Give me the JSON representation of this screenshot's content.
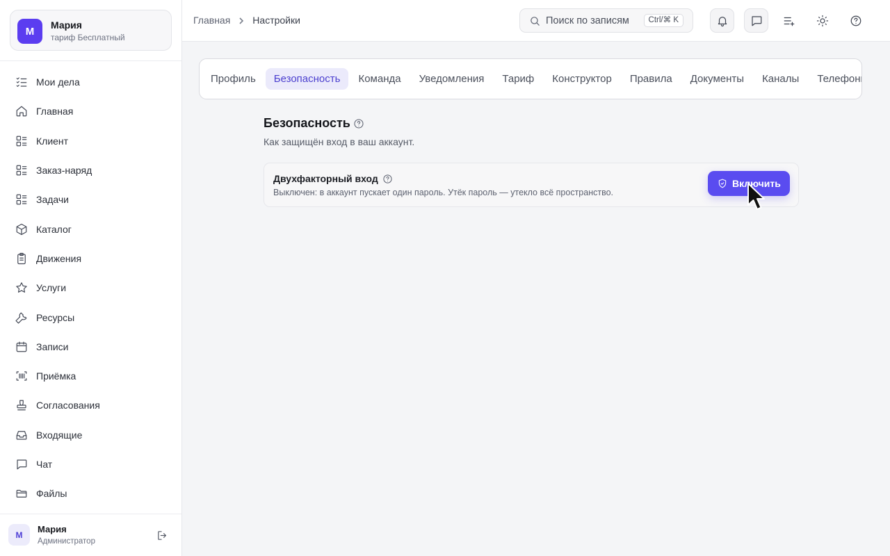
{
  "account": {
    "initial": "М",
    "name": "Мария",
    "plan": "тариф Бесплатный"
  },
  "sidebar": {
    "items": [
      {
        "label": "Мои дела",
        "icon": "list-check-icon"
      },
      {
        "label": "Главная",
        "icon": "home-icon"
      },
      {
        "label": "Клиент",
        "icon": "list-layout-icon"
      },
      {
        "label": "Заказ-наряд",
        "icon": "list-layout-icon"
      },
      {
        "label": "Задачи",
        "icon": "list-layout-icon"
      },
      {
        "label": "Каталог",
        "icon": "box-icon"
      },
      {
        "label": "Движения",
        "icon": "clipboard-icon"
      },
      {
        "label": "Услуги",
        "icon": "star-icon"
      },
      {
        "label": "Ресурсы",
        "icon": "wrench-icon"
      },
      {
        "label": "Записи",
        "icon": "calendar-icon"
      },
      {
        "label": "Приёмка",
        "icon": "barcode-scan-icon"
      },
      {
        "label": "Согласования",
        "icon": "stamp-icon"
      },
      {
        "label": "Входящие",
        "icon": "inbox-icon"
      },
      {
        "label": "Чат",
        "icon": "chat-icon"
      },
      {
        "label": "Файлы",
        "icon": "folder-icon"
      }
    ]
  },
  "user": {
    "initial": "М",
    "name": "Мария",
    "role": "Администратор"
  },
  "header": {
    "breadcrumb": {
      "home": "Главная",
      "current": "Настройки"
    },
    "search": {
      "placeholder": "Поиск по записям",
      "shortcut": "Ctrl/⌘ K"
    }
  },
  "tabs": [
    {
      "label": "Профиль",
      "active": false
    },
    {
      "label": "Безопасность",
      "active": true
    },
    {
      "label": "Команда",
      "active": false
    },
    {
      "label": "Уведомления",
      "active": false
    },
    {
      "label": "Тариф",
      "active": false
    },
    {
      "label": "Конструктор",
      "active": false
    },
    {
      "label": "Правила",
      "active": false
    },
    {
      "label": "Документы",
      "active": false
    },
    {
      "label": "Каналы",
      "active": false
    },
    {
      "label": "Телефония",
      "active": false
    }
  ],
  "section": {
    "title": "Безопасность",
    "description": "Как защищён вход в ваш аккаунт.",
    "two_factor": {
      "title": "Двухфакторный вход",
      "description": "Выключен: в аккаунт пускает один пароль. Утёк пароль — утекло всё пространство.",
      "button_label": "Включить"
    }
  },
  "colors": {
    "accent": "#5a4cf0",
    "avatar": "#5b3df0",
    "active_tab_bg": "#ebeafb"
  }
}
